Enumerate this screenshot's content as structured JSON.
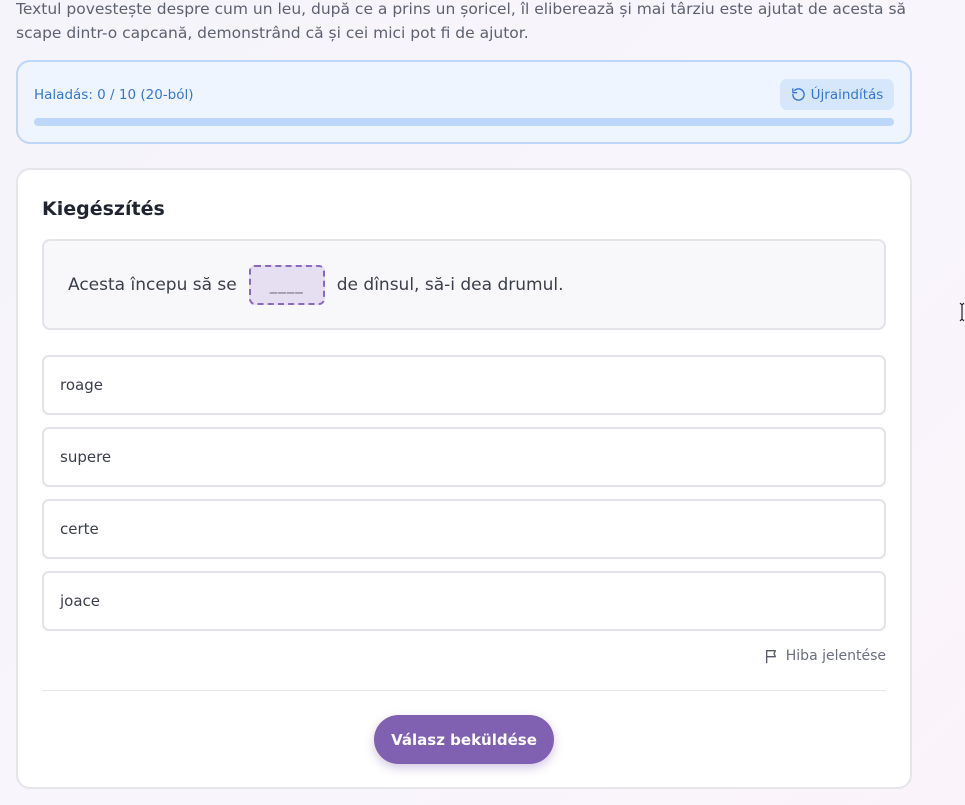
{
  "intro": {
    "text": "Textul povestește despre cum un leu, după ce a prins un șoricel, îl eliberează și mai târziu este ajutat de acesta să scape dintr-o capcană, demonstrând că și cei mici pot fi de ajutor."
  },
  "progress": {
    "label": "Haladás: 0 / 10 (20-ból)",
    "restart_label": "Újraindítás",
    "value": 0
  },
  "quiz": {
    "title": "Kiegészítés",
    "sentence_before": "Acesta începu să se",
    "blank": "____",
    "sentence_after": "de dînsul, să-i dea drumul.",
    "options": [
      {
        "label": "roage"
      },
      {
        "label": "supere"
      },
      {
        "label": "certe"
      },
      {
        "label": "joace"
      }
    ],
    "report_label": "Hiba jelentése",
    "submit_label": "Válasz beküldése"
  },
  "colors": {
    "accent": "#7f60b1",
    "progress_blue": "#3677cf"
  }
}
